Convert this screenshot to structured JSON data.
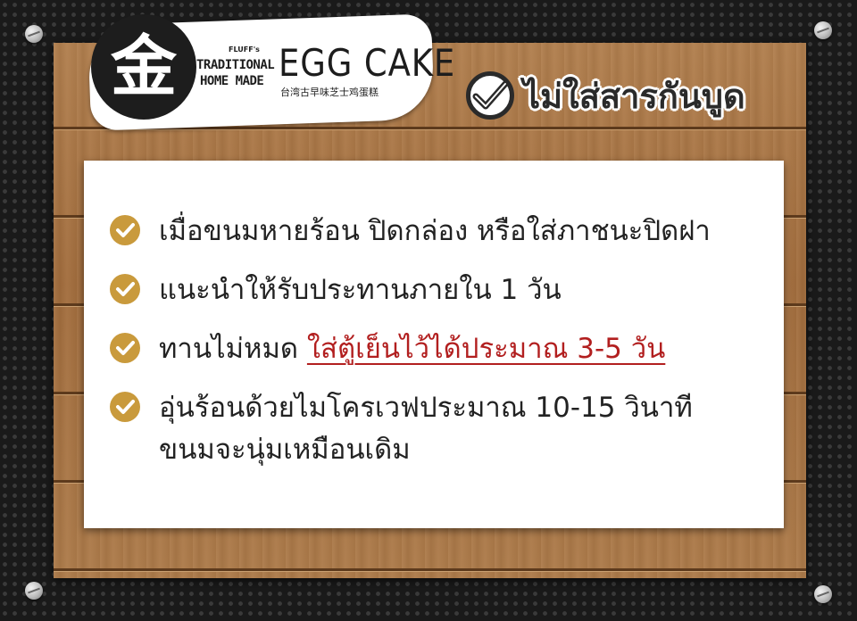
{
  "logo": {
    "glyph": "金",
    "brand_small": "FLUFF's",
    "line1": "TRADITIONAL",
    "line2": "HOME MADE",
    "title": "EGG CAKE",
    "subtitle_cn": "台湾古早味芝士鸡蛋糕"
  },
  "badge": {
    "icon": "check-circle-icon",
    "text": "ไม่ใส่สารกันบูด"
  },
  "items": [
    {
      "icon": "check-circle-icon",
      "text": "เมื่อขนมหายร้อน ปิดกล่อง หรือใส่ภาชนะปิดฝา"
    },
    {
      "icon": "check-circle-icon",
      "text": "แนะนำให้รับประทานภายใน 1 วัน"
    },
    {
      "icon": "check-circle-icon",
      "prefix": "ทานไม่หมด ",
      "highlight": "ใส่ตู้เย็นไว้ได้ประมาณ 3-5 วัน"
    },
    {
      "icon": "check-circle-icon",
      "line1": "อุ่นร้อนด้วยไมโครเวฟประมาณ 10-15 วินาที",
      "line2": "ขนมจะนุ่มเหมือนเดิม"
    }
  ],
  "colors": {
    "check_gold": "#c99a3c",
    "highlight_red": "#b21f1f",
    "wood": "#a87443",
    "background": "#1a1a1a"
  }
}
